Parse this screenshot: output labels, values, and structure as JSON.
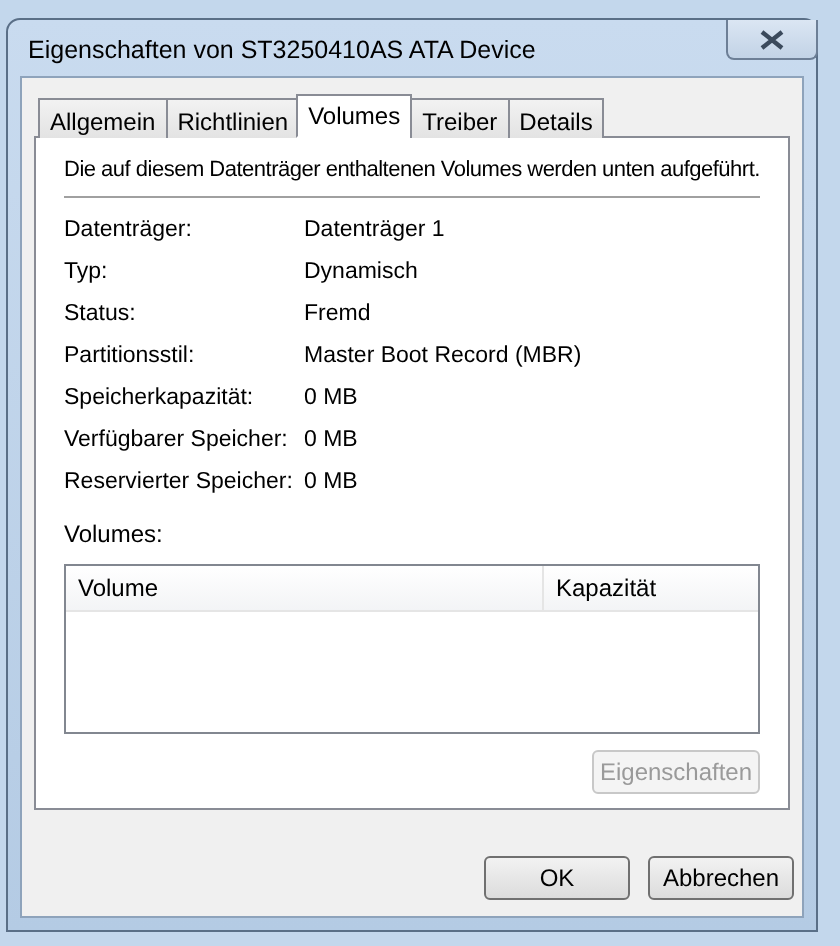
{
  "window": {
    "title": "Eigenschaften von ST3250410AS ATA Device"
  },
  "tabs": [
    {
      "label": "Allgemein",
      "selected": false
    },
    {
      "label": "Richtlinien",
      "selected": false
    },
    {
      "label": "Volumes",
      "selected": true
    },
    {
      "label": "Treiber",
      "selected": false
    },
    {
      "label": "Details",
      "selected": false
    }
  ],
  "intro": "Die auf diesem Datenträger enthaltenen Volumes werden unten aufgeführt.",
  "properties": [
    {
      "label": "Datenträger:",
      "value": "Datenträger 1"
    },
    {
      "label": "Typ:",
      "value": "Dynamisch"
    },
    {
      "label": "Status:",
      "value": "Fremd"
    },
    {
      "label": "Partitionsstil:",
      "value": "Master Boot Record (MBR)"
    },
    {
      "label": "Speicherkapazität:",
      "value": "0 MB"
    },
    {
      "label": "Verfügbarer Speicher:",
      "value": "0 MB"
    },
    {
      "label": "Reservierter Speicher:",
      "value": "0 MB"
    }
  ],
  "volumes": {
    "label": "Volumes:",
    "columns": [
      "Volume",
      "Kapazität"
    ]
  },
  "volume_button": {
    "label": "Eigenschaften",
    "disabled": true
  },
  "dialog_buttons": [
    {
      "label": "OK",
      "disabled": false
    },
    {
      "label": "Abbrechen",
      "disabled": false
    }
  ]
}
